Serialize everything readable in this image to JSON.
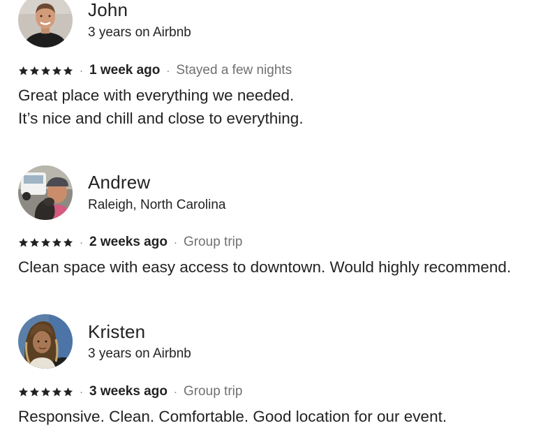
{
  "reviews": [
    {
      "name": "John",
      "subtitle": "3 years on Airbnb",
      "rating": 5,
      "when": "1 week ago",
      "trip": "Stayed a few nights",
      "lines": [
        "Great place with everything we needed.",
        "It’s nice and chill and close to everything."
      ]
    },
    {
      "name": "Andrew",
      "subtitle": "Raleigh, North Carolina",
      "rating": 5,
      "when": "2 weeks ago",
      "trip": "Group trip",
      "lines": [
        "Clean space with easy access to downtown. Would highly recommend."
      ]
    },
    {
      "name": "Kristen",
      "subtitle": "3 years on Airbnb",
      "rating": 5,
      "when": "3 weeks ago",
      "trip": "Group trip",
      "lines": [
        "Responsive. Clean. Comfortable. Good location for our event."
      ]
    }
  ],
  "separator": "·",
  "colors": {
    "text": "#222222",
    "muted": "#717171",
    "star": "#222222"
  },
  "icons": {
    "star": "star-icon"
  }
}
